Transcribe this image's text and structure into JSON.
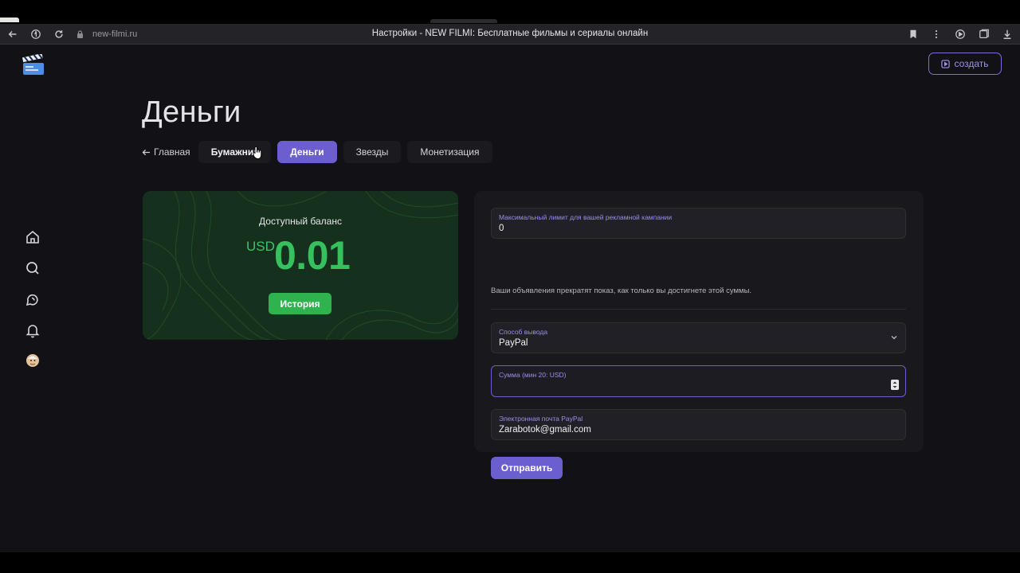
{
  "browser": {
    "url": "new-filmi.ru",
    "window_title": "Настройки - NEW FILMI: Бесплатные фильмы и сериалы онлайн"
  },
  "header": {
    "create_label": "создать"
  },
  "page": {
    "title": "Деньги"
  },
  "tabs": {
    "back_label": "Главная",
    "items": [
      "Бумажник",
      "Деньги",
      "Звезды",
      "Монетизация"
    ],
    "active": "Деньги"
  },
  "balance": {
    "label": "Доступный баланс",
    "currency": "USD",
    "amount": "0.01",
    "history_label": "История"
  },
  "form": {
    "limit_label": "Максимальный лимит для вашей рекламной кампании",
    "limit_value": "0",
    "limit_hint": "Ваши объявления прекратят показ, как только вы достигнете этой суммы.",
    "method_label": "Способ вывода",
    "method_value": "PayPal",
    "amount_label": "Сумма (мин 20: USD)",
    "amount_value": "",
    "email_label": "Электронная почта PayPal",
    "email_value": "Zarabotok@gmail.com",
    "submit_label": "Отправить"
  },
  "colors": {
    "accent": "#6b5fcf",
    "balance_green": "#36c05e",
    "card_bg": "#15301d",
    "page_bg": "#111116"
  }
}
